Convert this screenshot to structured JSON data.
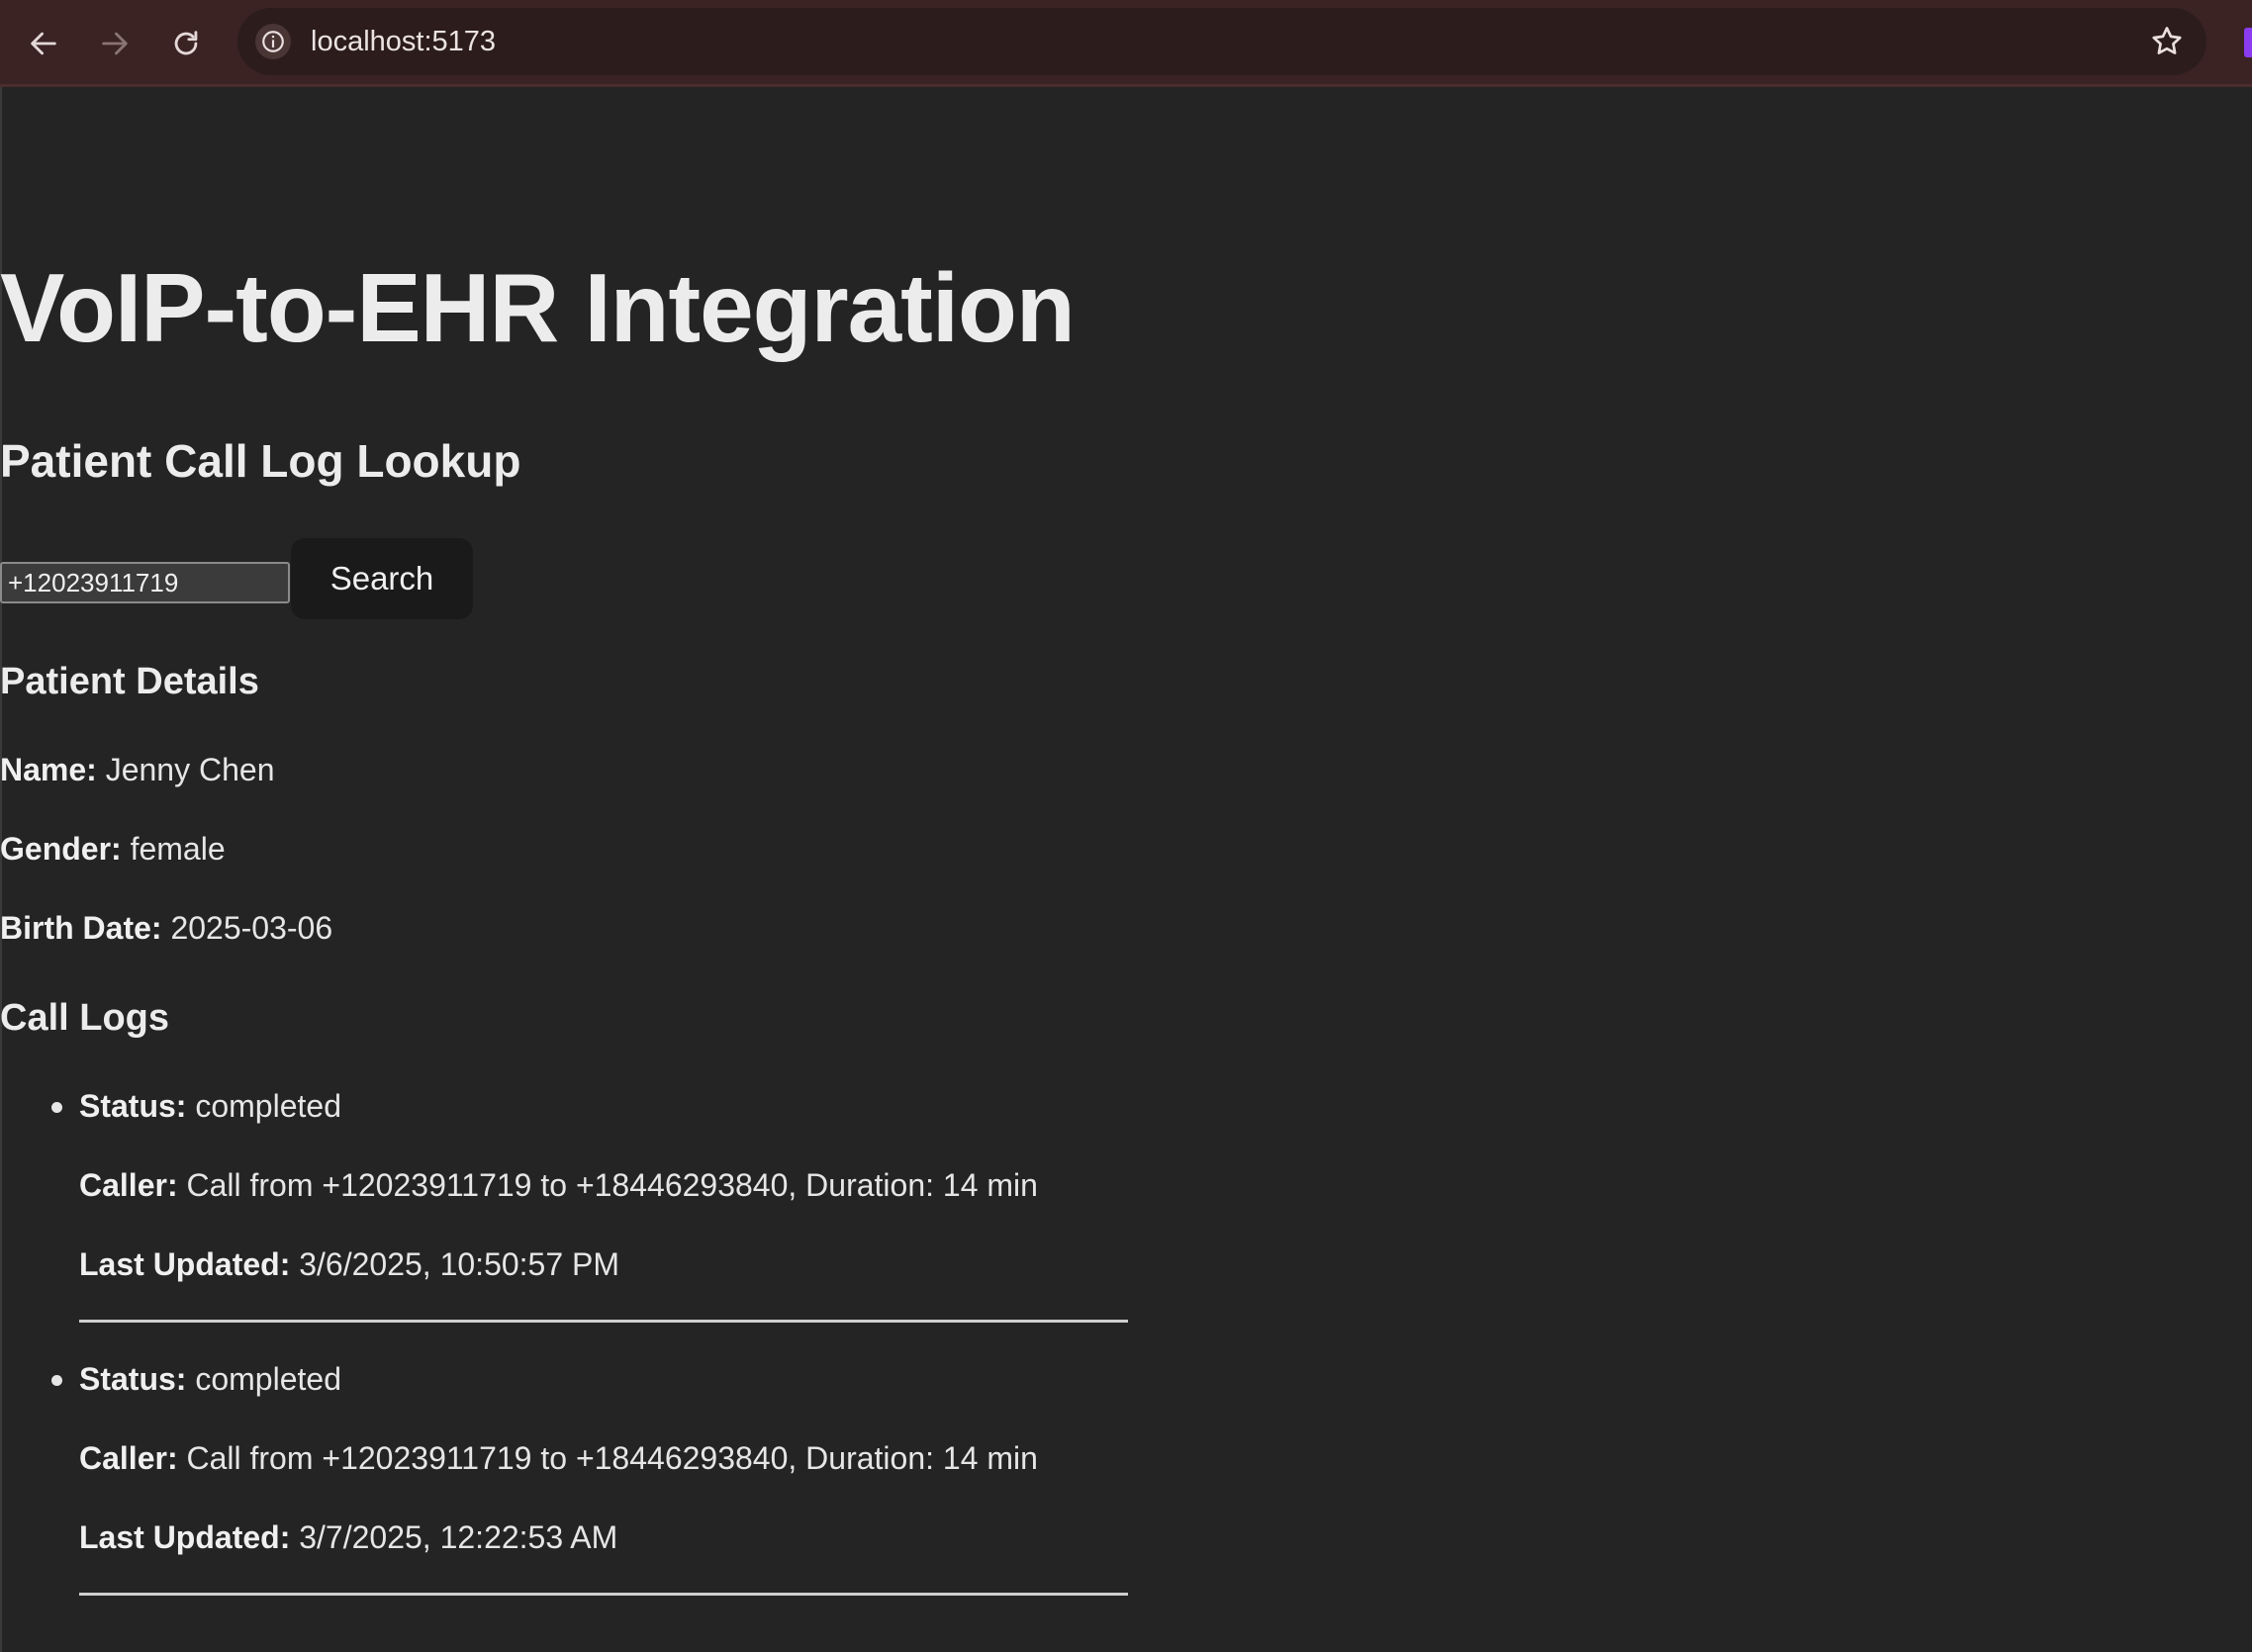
{
  "browser": {
    "url": "localhost:5173"
  },
  "page": {
    "title": "VoIP-to-EHR Integration",
    "subtitle": "Patient Call Log Lookup",
    "search": {
      "value": "+12023911719",
      "button_label": "Search"
    },
    "patient": {
      "heading": "Patient Details",
      "name_label": "Name:",
      "name": "Jenny Chen",
      "gender_label": "Gender:",
      "gender": "female",
      "birth_label": "Birth Date:",
      "birth_date": "2025-03-06"
    },
    "call_logs": {
      "heading": "Call Logs",
      "status_label": "Status:",
      "caller_label": "Caller:",
      "updated_label": "Last Updated:",
      "items": [
        {
          "status": "completed",
          "caller": "Call from +12023911719 to +18446293840, Duration: 14 min",
          "last_updated": "3/6/2025, 10:50:57 PM"
        },
        {
          "status": "completed",
          "caller": "Call from +12023911719 to +18446293840, Duration: 14 min",
          "last_updated": "3/7/2025, 12:22:53 AM"
        }
      ]
    }
  }
}
